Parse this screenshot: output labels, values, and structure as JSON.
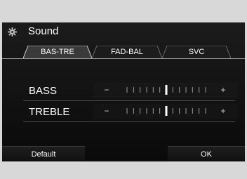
{
  "header": {
    "title": "Sound",
    "icon": "gear-icon"
  },
  "tabs": [
    {
      "label": "BAS-TRE",
      "active": true
    },
    {
      "label": "FAD-BAL",
      "active": false
    },
    {
      "label": "SVC",
      "active": false
    }
  ],
  "controls": [
    {
      "label": "BASS",
      "minus": "−",
      "plus": "+",
      "level": 0,
      "range": [
        -6,
        6
      ]
    },
    {
      "label": "TREBLE",
      "minus": "−",
      "plus": "+",
      "level": 0,
      "range": [
        -6,
        6
      ]
    }
  ],
  "footer": {
    "default_label": "Default",
    "ok_label": "OK"
  },
  "colors": {
    "background": "#0f0f0f",
    "text": "#ffffff",
    "outer": "#d8d8d8"
  }
}
